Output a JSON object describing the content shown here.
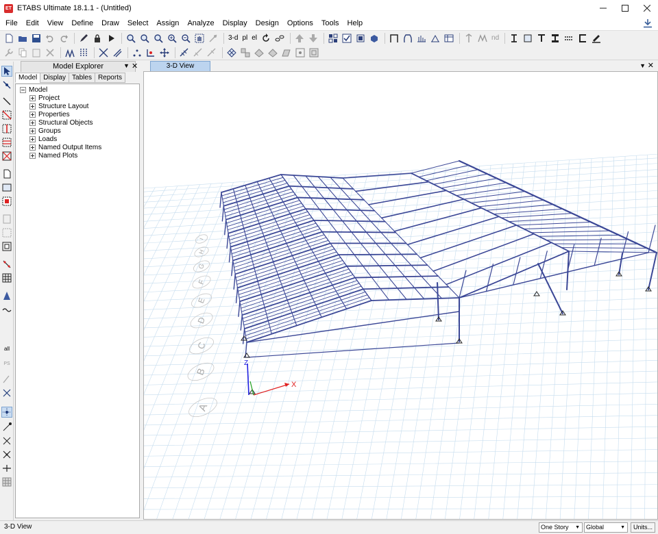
{
  "titlebar": {
    "title": "ETABS Ultimate 18.1.1 - (Untitled)",
    "logo_text": "ET",
    "icons": [
      "minimize-icon",
      "maximize-icon",
      "close-icon"
    ]
  },
  "menu": {
    "items": [
      "File",
      "Edit",
      "View",
      "Define",
      "Draw",
      "Select",
      "Assign",
      "Analyze",
      "Display",
      "Design",
      "Options",
      "Tools",
      "Help"
    ]
  },
  "toolbar": {
    "view_3d_label": "3-d",
    "plan_label": "pl",
    "elev_label": "el",
    "nd_label": "nd"
  },
  "left_toolbar": {
    "all_label": "all",
    "ps_label": "PS"
  },
  "explorer": {
    "title": "Model Explorer",
    "tabs": [
      "Model",
      "Display",
      "Tables",
      "Reports"
    ],
    "active_tab": "Model",
    "tree": {
      "root": "Model",
      "children": [
        "Project",
        "Structure Layout",
        "Properties",
        "Structural Objects",
        "Groups",
        "Loads",
        "Named Output Items",
        "Named Plots"
      ]
    }
  },
  "view": {
    "tab_label": "3-D View",
    "grid_labels": [
      "A",
      "B",
      "C",
      "D",
      "E",
      "F",
      "G",
      "H",
      "I"
    ],
    "axis_x_label": "X",
    "axis_z_label": "Z",
    "colors": {
      "frame": "#3b4796",
      "grid": "#c5dcee",
      "axis_x": "#e02020",
      "axis_y": "#20a020",
      "axis_z": "#2020e0"
    }
  },
  "status": {
    "text": "3-D View",
    "story": "One Story",
    "coord": "Global",
    "units_button": "Units..."
  }
}
